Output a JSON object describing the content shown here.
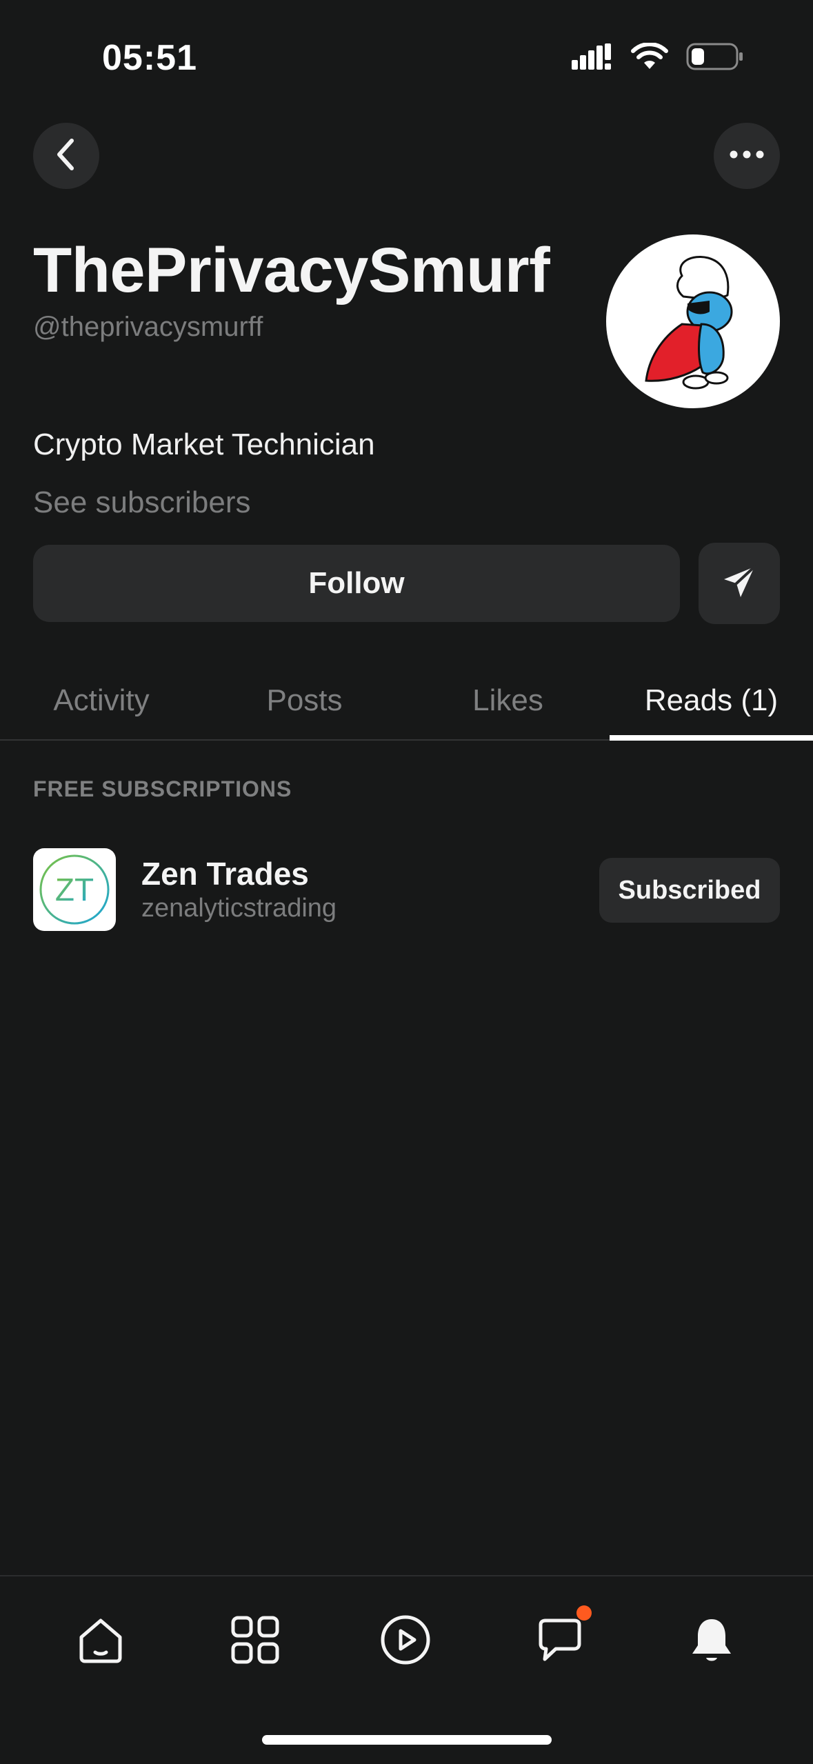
{
  "status_bar": {
    "time": "05:51"
  },
  "header": {
    "back_icon": "chevron-left-icon",
    "more_icon": "ellipsis-icon"
  },
  "profile": {
    "name": "ThePrivacySmurf",
    "handle": "@theprivacysmurff",
    "bio": "Crypto Market Technician",
    "see_subscribers": "See subscribers",
    "follow_label": "Follow",
    "message_icon": "send-icon"
  },
  "tabs": [
    {
      "label": "Activity",
      "active": false
    },
    {
      "label": "Posts",
      "active": false
    },
    {
      "label": "Likes",
      "active": false
    },
    {
      "label": "Reads (1)",
      "active": true
    }
  ],
  "section": {
    "heading": "FREE SUBSCRIPTIONS",
    "items": [
      {
        "logo_text": "ZT",
        "name": "Zen Trades",
        "handle": "zenalyticstrading",
        "button_label": "Subscribed"
      }
    ]
  },
  "bottom_nav": {
    "items": [
      "home-icon",
      "grid-icon",
      "play-icon",
      "chat-icon",
      "bell-icon"
    ],
    "chat_has_badge": true,
    "badge_color": "#ff5a1f"
  },
  "colors": {
    "background": "#171818",
    "surface": "#2a2b2c",
    "muted_text": "#7c7d7e",
    "primary_text": "#f4f4f4"
  }
}
